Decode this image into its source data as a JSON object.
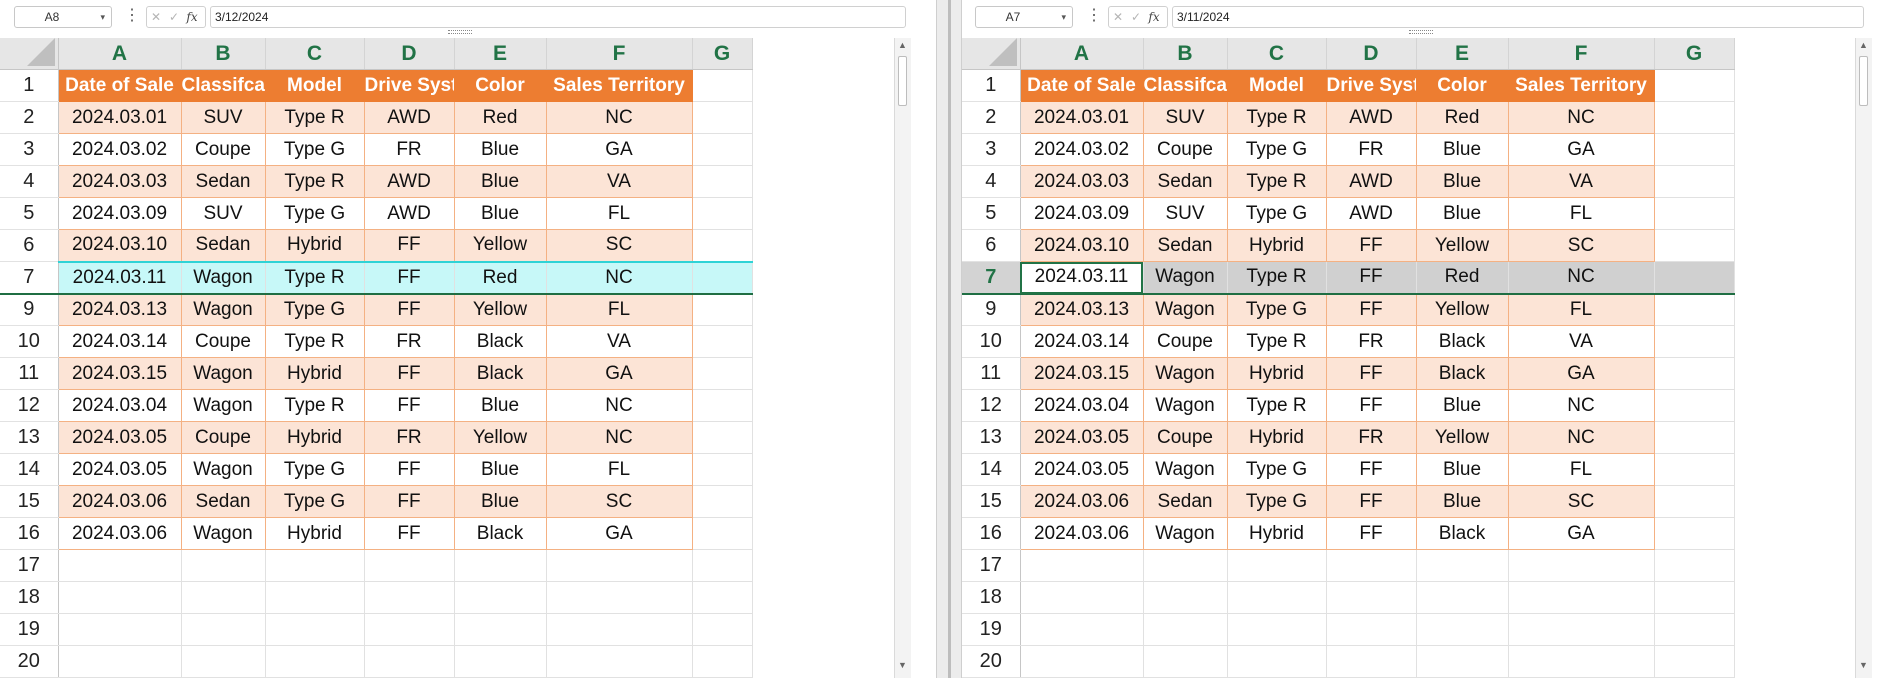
{
  "left": {
    "namebox": "A8",
    "formula": "3/12/2024",
    "selected_row_label": "7",
    "rows": [
      {
        "num": "1",
        "cells": [
          "Date of Sale",
          "Classifcation",
          "Model",
          "Drive System",
          "Color",
          "Sales Territory"
        ]
      },
      {
        "num": "2",
        "cells": [
          "2024.03.01",
          "SUV",
          "Type R",
          "AWD",
          "Red",
          "NC"
        ]
      },
      {
        "num": "3",
        "cells": [
          "2024.03.02",
          "Coupe",
          "Type G",
          "FR",
          "Blue",
          "GA"
        ]
      },
      {
        "num": "4",
        "cells": [
          "2024.03.03",
          "Sedan",
          "Type R",
          "AWD",
          "Blue",
          "VA"
        ]
      },
      {
        "num": "5",
        "cells": [
          "2024.03.09",
          "SUV",
          "Type G",
          "AWD",
          "Blue",
          "FL"
        ]
      },
      {
        "num": "6",
        "cells": [
          "2024.03.10",
          "Sedan",
          "Hybrid",
          "FF",
          "Yellow",
          "SC"
        ]
      },
      {
        "num": "7",
        "cells": [
          "2024.03.11",
          "Wagon",
          "Type R",
          "FF",
          "Red",
          "NC"
        ]
      },
      {
        "num": "9",
        "cells": [
          "2024.03.13",
          "Wagon",
          "Type G",
          "FF",
          "Yellow",
          "FL"
        ]
      },
      {
        "num": "10",
        "cells": [
          "2024.03.14",
          "Coupe",
          "Type R",
          "FR",
          "Black",
          "VA"
        ]
      },
      {
        "num": "11",
        "cells": [
          "2024.03.15",
          "Wagon",
          "Hybrid",
          "FF",
          "Black",
          "GA"
        ]
      },
      {
        "num": "12",
        "cells": [
          "2024.03.04",
          "Wagon",
          "Type R",
          "FF",
          "Blue",
          "NC"
        ]
      },
      {
        "num": "13",
        "cells": [
          "2024.03.05",
          "Coupe",
          "Hybrid",
          "FR",
          "Yellow",
          "NC"
        ]
      },
      {
        "num": "14",
        "cells": [
          "2024.03.05",
          "Wagon",
          "Type G",
          "FF",
          "Blue",
          "FL"
        ]
      },
      {
        "num": "15",
        "cells": [
          "2024.03.06",
          "Sedan",
          "Type G",
          "FF",
          "Blue",
          "SC"
        ]
      },
      {
        "num": "16",
        "cells": [
          "2024.03.06",
          "Wagon",
          "Hybrid",
          "FF",
          "Black",
          "GA"
        ]
      },
      {
        "num": "17",
        "cells": [
          "",
          "",
          "",
          "",
          "",
          ""
        ]
      },
      {
        "num": "18",
        "cells": [
          "",
          "",
          "",
          "",
          "",
          ""
        ]
      },
      {
        "num": "19",
        "cells": [
          "",
          "",
          "",
          "",
          "",
          ""
        ]
      },
      {
        "num": "20",
        "cells": [
          "",
          "",
          "",
          "",
          "",
          ""
        ]
      }
    ]
  },
  "right": {
    "namebox": "A7",
    "formula": "3/11/2024",
    "selected_row_label": "7",
    "rows": [
      {
        "num": "1",
        "cells": [
          "Date of Sale",
          "Classifcation",
          "Model",
          "Drive System",
          "Color",
          "Sales Territory"
        ]
      },
      {
        "num": "2",
        "cells": [
          "2024.03.01",
          "SUV",
          "Type R",
          "AWD",
          "Red",
          "NC"
        ]
      },
      {
        "num": "3",
        "cells": [
          "2024.03.02",
          "Coupe",
          "Type G",
          "FR",
          "Blue",
          "GA"
        ]
      },
      {
        "num": "4",
        "cells": [
          "2024.03.03",
          "Sedan",
          "Type R",
          "AWD",
          "Blue",
          "VA"
        ]
      },
      {
        "num": "5",
        "cells": [
          "2024.03.09",
          "SUV",
          "Type G",
          "AWD",
          "Blue",
          "FL"
        ]
      },
      {
        "num": "6",
        "cells": [
          "2024.03.10",
          "Sedan",
          "Hybrid",
          "FF",
          "Yellow",
          "SC"
        ]
      },
      {
        "num": "7",
        "cells": [
          "2024.03.11",
          "Wagon",
          "Type R",
          "FF",
          "Red",
          "NC"
        ]
      },
      {
        "num": "9",
        "cells": [
          "2024.03.13",
          "Wagon",
          "Type G",
          "FF",
          "Yellow",
          "FL"
        ]
      },
      {
        "num": "10",
        "cells": [
          "2024.03.14",
          "Coupe",
          "Type R",
          "FR",
          "Black",
          "VA"
        ]
      },
      {
        "num": "11",
        "cells": [
          "2024.03.15",
          "Wagon",
          "Hybrid",
          "FF",
          "Black",
          "GA"
        ]
      },
      {
        "num": "12",
        "cells": [
          "2024.03.04",
          "Wagon",
          "Type R",
          "FF",
          "Blue",
          "NC"
        ]
      },
      {
        "num": "13",
        "cells": [
          "2024.03.05",
          "Coupe",
          "Hybrid",
          "FR",
          "Yellow",
          "NC"
        ]
      },
      {
        "num": "14",
        "cells": [
          "2024.03.05",
          "Wagon",
          "Type G",
          "FF",
          "Blue",
          "FL"
        ]
      },
      {
        "num": "15",
        "cells": [
          "2024.03.06",
          "Sedan",
          "Type G",
          "FF",
          "Blue",
          "SC"
        ]
      },
      {
        "num": "16",
        "cells": [
          "2024.03.06",
          "Wagon",
          "Hybrid",
          "FF",
          "Black",
          "GA"
        ]
      },
      {
        "num": "17",
        "cells": [
          "",
          "",
          "",
          "",
          "",
          ""
        ]
      },
      {
        "num": "18",
        "cells": [
          "",
          "",
          "",
          "",
          "",
          ""
        ]
      },
      {
        "num": "19",
        "cells": [
          "",
          "",
          "",
          "",
          "",
          ""
        ]
      },
      {
        "num": "20",
        "cells": [
          "",
          "",
          "",
          "",
          "",
          ""
        ]
      }
    ]
  },
  "columns": [
    "A",
    "B",
    "C",
    "D",
    "E",
    "F",
    "G"
  ],
  "formula_bar_icons": {
    "cancel": "✕",
    "enter": "✓",
    "fx": "fx",
    "more": "⋮",
    "dropdown": "▾"
  },
  "colors": {
    "header_fill": "#ED7D31",
    "band_fill": "#FCE4D6",
    "highlight_row": "#C7F8F8",
    "selected_gray": "#D0D0D0",
    "accent_green": "#217346"
  }
}
